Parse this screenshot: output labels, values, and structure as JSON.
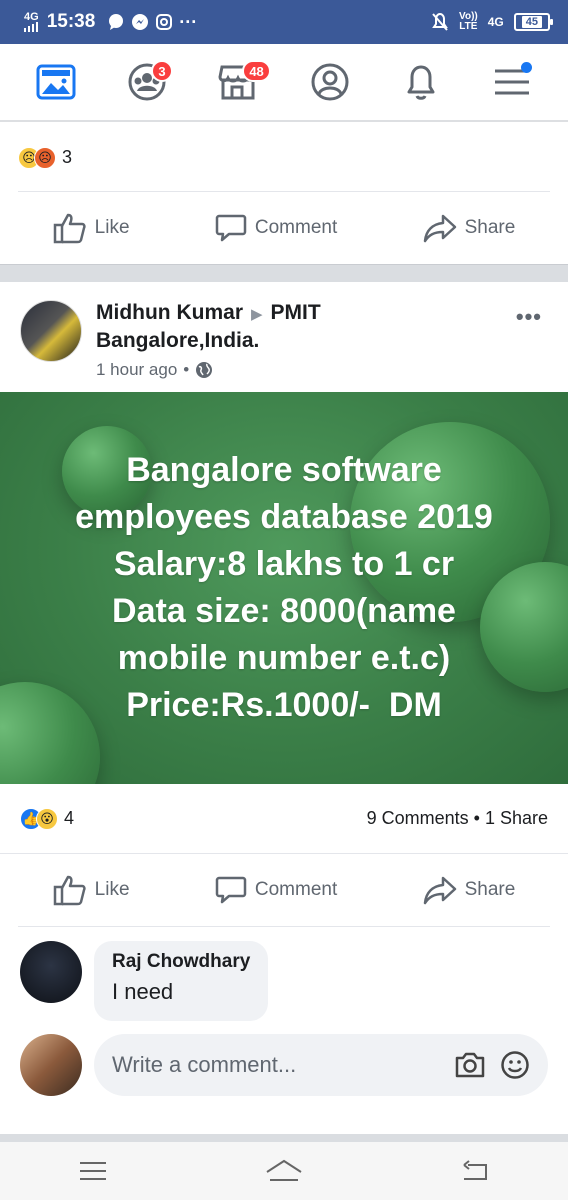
{
  "status_bar": {
    "network": "4G",
    "time": "15:38",
    "volte": "Vo))\nLTE",
    "network_right": "4G",
    "battery": "45"
  },
  "nav": {
    "friends_badge": "3",
    "marketplace_badge": "48"
  },
  "previous_post": {
    "reaction_count": "3",
    "like_label": "Like",
    "comment_label": "Comment",
    "share_label": "Share"
  },
  "post": {
    "author": "Midhun Kumar",
    "group": "PMIT",
    "group_line2": "Bangalore,India.",
    "time": "1 hour ago",
    "text_lines": [
      "Bangalore software",
      "employees database 2019",
      "Salary:8 lakhs to 1 cr",
      "Data size: 8000(name",
      "mobile number e.t.c)",
      "Price:Rs.1000/-  DM"
    ],
    "reaction_count": "4",
    "comments_shares": "9 Comments • 1 Share",
    "like_label": "Like",
    "comment_label": "Comment",
    "share_label": "Share"
  },
  "comment": {
    "author": "Raj Chowdhary",
    "text": "I need"
  },
  "write_comment": {
    "placeholder": "Write a comment..."
  },
  "colors": {
    "header_blue": "#3b5998",
    "badge_red": "#fa3e3e",
    "post_bg_green": "#3b7f48"
  }
}
